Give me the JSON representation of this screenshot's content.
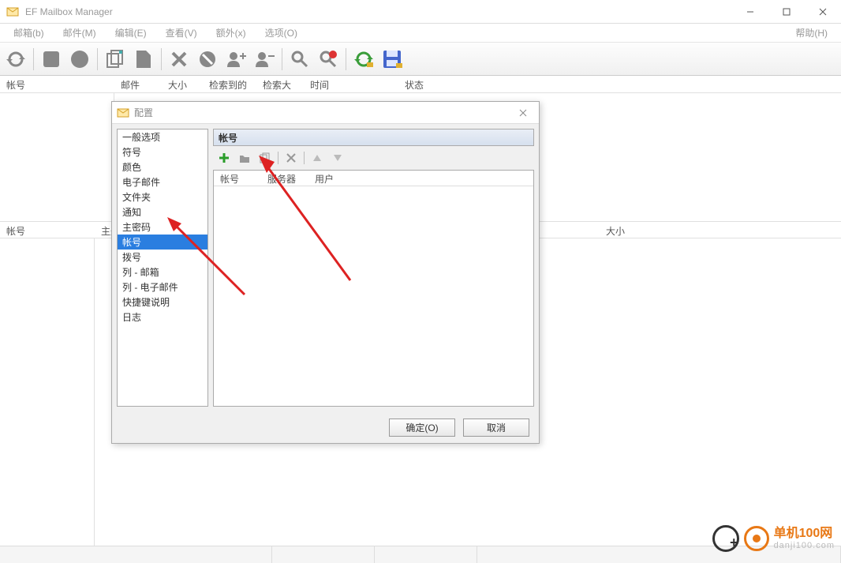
{
  "window": {
    "title": "EF Mailbox Manager"
  },
  "menus": {
    "mailbox": "邮箱(b)",
    "mail": "邮件(M)",
    "edit": "编辑(E)",
    "view": "查看(V)",
    "extra": "额外(x)",
    "options": "选项(O)",
    "help": "帮助(H)"
  },
  "upper_columns": {
    "account": "帐号",
    "mail": "邮件",
    "size": "大小",
    "found": "检索到的",
    "found_size": "检索大小",
    "time": "时间",
    "state": "状态"
  },
  "lower_columns": {
    "account": "帐号",
    "subject": "主题",
    "size": "大小"
  },
  "dialog": {
    "title": "配置",
    "nav": [
      "一般选项",
      "符号",
      "颜色",
      "电子邮件",
      "文件夹",
      "通知",
      "主密码",
      "帐号",
      "拨号",
      "列 - 邮箱",
      "列 - 电子邮件",
      "快捷键说明",
      "日志"
    ],
    "selected_index": 7,
    "panel_title": "帐号",
    "list_columns": {
      "account": "帐号",
      "server": "服务器",
      "user": "用户"
    },
    "buttons": {
      "ok": "确定(O)",
      "cancel": "取消"
    }
  },
  "watermark": {
    "line1": "单机100网",
    "line2": "danji100.com"
  }
}
